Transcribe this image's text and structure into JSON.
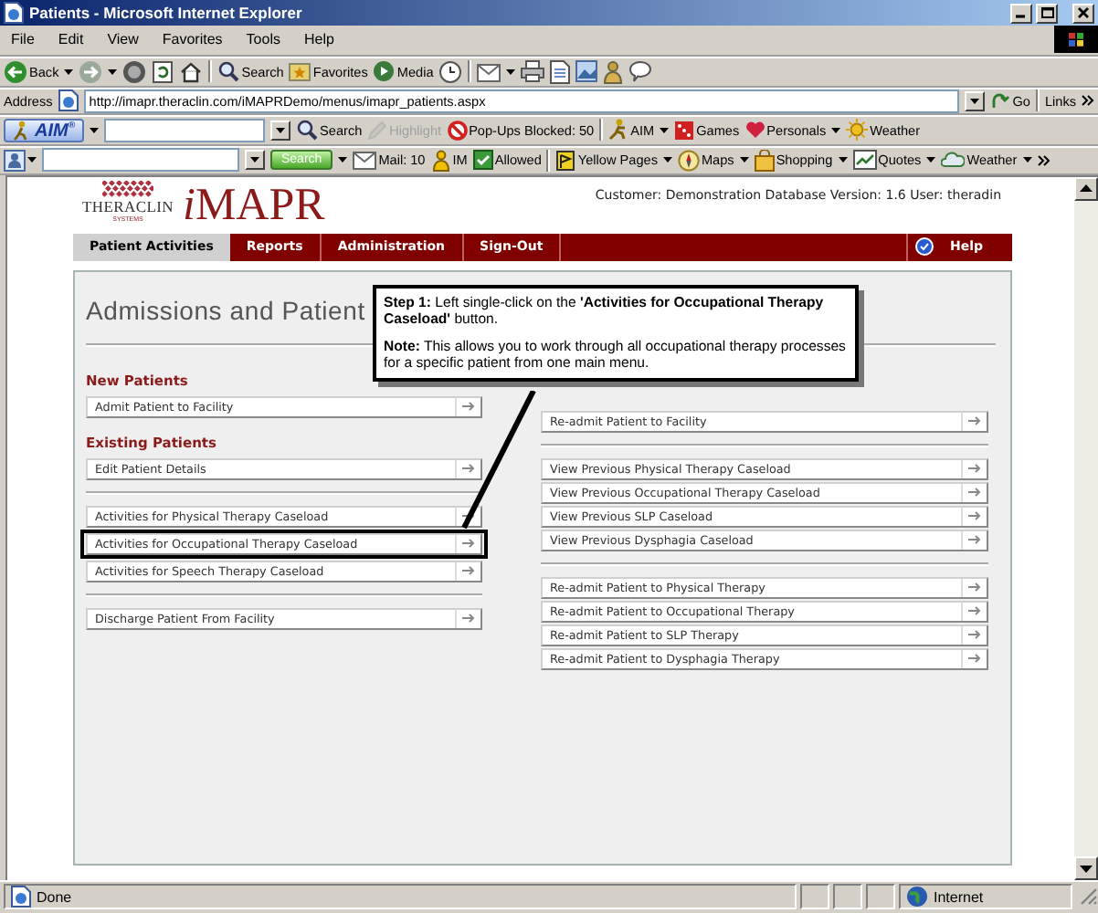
{
  "window": {
    "title": "Patients - Microsoft Internet Explorer"
  },
  "menu_bar": [
    "File",
    "Edit",
    "View",
    "Favorites",
    "Tools",
    "Help"
  ],
  "toolbar": [
    {
      "label": "Back",
      "menu": true
    },
    {
      "label": "Search",
      "menu": false
    },
    {
      "label": "Favorites",
      "menu": false
    },
    {
      "label": "Media",
      "menu": false
    }
  ],
  "address_bar": {
    "label": "Address",
    "value": "http://imapr.theraclin.com/iMAPRDemo/menus/imapr_patients.aspx",
    "go": "Go",
    "links": "Links"
  },
  "aim_toolbar": {
    "logo": "AIM$^{®}$",
    "items": [
      {
        "label": "Search",
        "menu": false,
        "disabled": false
      },
      {
        "label": "Highlight",
        "menu": false,
        "disabled": true
      },
      {
        "label": "Pop-Ups Blocked: 50",
        "menu": false,
        "disabled": false
      },
      {
        "label": "AIM",
        "menu": true,
        "disabled": false
      },
      {
        "label": "Games",
        "menu": false,
        "disabled": false
      },
      {
        "label": "Personals",
        "menu": true,
        "disabled": false
      },
      {
        "label": "Weather",
        "menu": false,
        "disabled": false
      }
    ]
  },
  "search_toolbar": {
    "search": "Search",
    "items": [
      {
        "label": "Mail: 10",
        "menu": false
      },
      {
        "label": "IM",
        "menu": false
      },
      {
        "label": "Allowed",
        "menu": false
      },
      {
        "label": "Yellow Pages",
        "menu": true
      },
      {
        "label": "Maps",
        "menu": true
      },
      {
        "label": "Shopping",
        "menu": true
      },
      {
        "label": "Quotes",
        "menu": true
      },
      {
        "label": "Weather",
        "menu": true
      }
    ]
  },
  "page": {
    "logo": {
      "brand": "THERACLIN",
      "sub": "SYSTEMS",
      "product": "iMAPR"
    },
    "info": "Customer: Demonstration Database Version: 1.6 User: theradin",
    "nav": [
      {
        "label": "Patient Activities",
        "selected": true
      },
      {
        "label": "Reports",
        "selected": false
      },
      {
        "label": "Administration",
        "selected": false
      },
      {
        "label": "Sign-Out",
        "selected": false
      }
    ],
    "help": "Help",
    "heading": "Admissions and Patient",
    "left_sections": [
      {
        "title": "New Patients",
        "groups": [
          [
            {
              "label": "Admit Patient to Facility",
              "highlighted": false
            }
          ]
        ]
      },
      {
        "title": "Existing Patients",
        "groups": [
          [
            {
              "label": "Edit Patient Details",
              "highlighted": false
            }
          ],
          [
            {
              "label": "Activities for Physical Therapy Caseload",
              "highlighted": false
            },
            {
              "label": "Activities for Occupational Therapy Caseload",
              "highlighted": true
            },
            {
              "label": "Activities for Speech Therapy Caseload",
              "highlighted": false
            }
          ],
          [
            {
              "label": "Discharge Patient From Facility",
              "highlighted": false
            }
          ]
        ]
      }
    ],
    "right_groups": [
      [
        {
          "label": "Re-admit Patient to Facility",
          "highlighted": false
        }
      ],
      [
        {
          "label": "View Previous Physical Therapy Caseload",
          "highlighted": false
        },
        {
          "label": "View Previous Occupational Therapy Caseload",
          "highlighted": false
        },
        {
          "label": "View Previous SLP Caseload",
          "highlighted": false
        },
        {
          "label": "View Previous Dysphagia Caseload",
          "highlighted": false
        }
      ],
      [
        {
          "label": "Re-admit Patient to Physical Therapy",
          "highlighted": false
        },
        {
          "label": "Re-admit Patient to Occupational Therapy",
          "highlighted": false
        },
        {
          "label": "Re-admit Patient to SLP Therapy",
          "highlighted": false
        },
        {
          "label": "Re-admit Patient to Dysphagia Therapy",
          "highlighted": false
        }
      ]
    ]
  },
  "callout": {
    "step": "**Step 1:** Left single-click on the **'Activities for Occupational Therapy Caseload'** button.",
    "note": "**Note:** This allows you to work through all occupational therapy processes for a specific patient from one main menu."
  },
  "status_bar": {
    "text": "Done",
    "zone": "Internet"
  }
}
